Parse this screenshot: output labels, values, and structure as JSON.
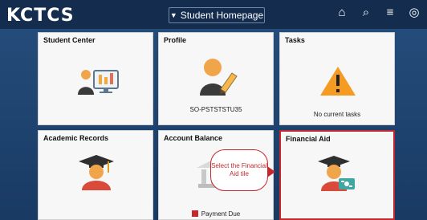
{
  "header": {
    "logo": "KCTCS",
    "page_menu": "Student Homepage",
    "icons": [
      "home-icon",
      "search-icon",
      "menu-icon",
      "compass-icon"
    ]
  },
  "tiles": [
    {
      "title": "Student Center",
      "footer": ""
    },
    {
      "title": "Profile",
      "footer": "SO-PSTSTSTU35"
    },
    {
      "title": "Tasks",
      "footer": "No current tasks"
    },
    {
      "title": "Academic Records",
      "footer": ""
    },
    {
      "title": "Account Balance",
      "footer": "Payment Due"
    },
    {
      "title": "Financial Aid",
      "footer": ""
    }
  ],
  "callout": {
    "text": "Select the Financial Aid tile"
  },
  "colors": {
    "topbar": "#142d4f",
    "background": "#1f3d63",
    "highlight": "#c5282c",
    "warning": "#f59b22"
  }
}
